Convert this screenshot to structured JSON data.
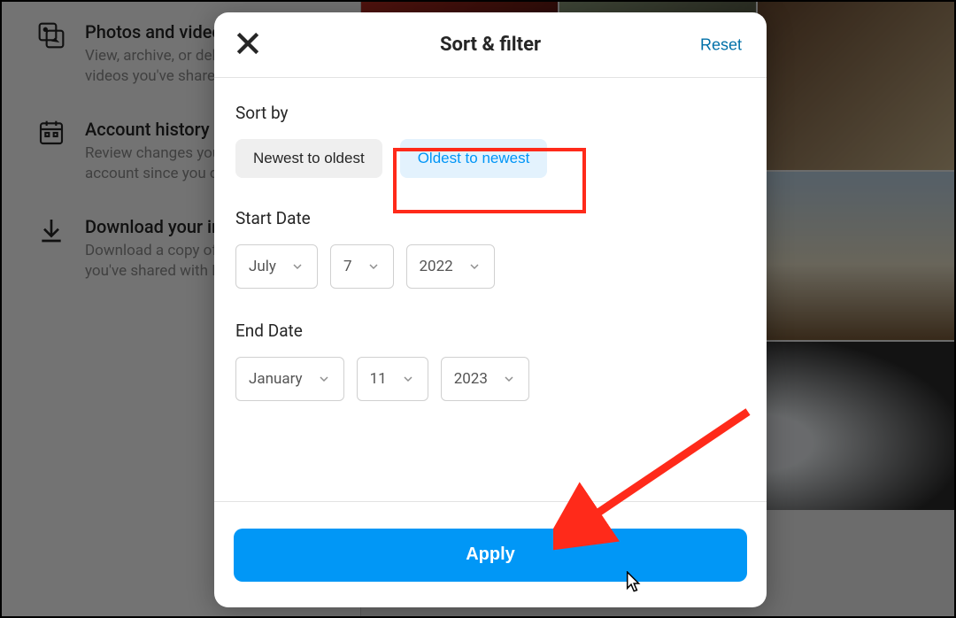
{
  "sidebar": [
    {
      "title": "Photos and videos",
      "desc": "View, archive, or delete photos and videos you've shared."
    },
    {
      "title": "Account history",
      "desc": "Review changes you've made to your account since you created it."
    },
    {
      "title": "Download your information",
      "desc": "Download a copy of the information you've shared with Instagram."
    }
  ],
  "modal": {
    "title": "Sort & filter",
    "reset": "Reset",
    "sort_label": "Sort by",
    "sort_newest": "Newest to oldest",
    "sort_oldest": "Oldest to newest",
    "start_label": "Start Date",
    "start": {
      "month": "July",
      "day": "7",
      "year": "2022"
    },
    "end_label": "End Date",
    "end": {
      "month": "January",
      "day": "11",
      "year": "2023"
    },
    "apply": "Apply"
  }
}
